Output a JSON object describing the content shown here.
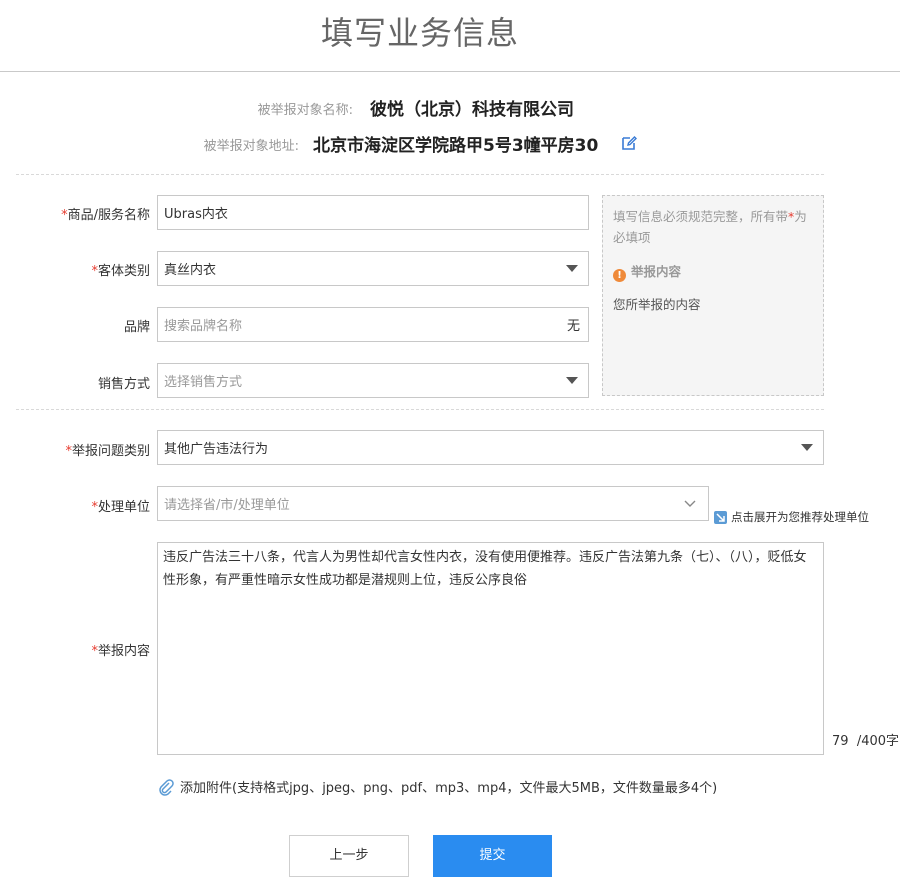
{
  "page": {
    "title": "填写业务信息"
  },
  "target": {
    "name_label": "被举报对象名称:",
    "name_value": "彼悦（北京）科技有限公司",
    "address_label": "被举报对象地址:",
    "address_value": "北京市海淀区学院路甲5号3幢平房30",
    "edit_icon": "edit-icon"
  },
  "form": {
    "required_mark": "*",
    "product": {
      "label": "商品/服务名称",
      "value": "Ubras内衣"
    },
    "category": {
      "label": "客体类别",
      "value": "真丝内衣"
    },
    "brand": {
      "label": "品牌",
      "placeholder": "搜索品牌名称",
      "suffix": "无"
    },
    "sales": {
      "label": "销售方式",
      "placeholder": "选择销售方式"
    },
    "issue_type": {
      "label": "举报问题类别",
      "value": "其他广告违法行为"
    },
    "handler": {
      "label": "处理单位",
      "placeholder": "请选择省/市/处理单位",
      "hint": "点击展开为您推荐处理单位"
    },
    "content": {
      "label": "举报内容",
      "value": "违反广告法三十八条，代言人为男性却代言女性内衣，没有使用便推荐。违反广告法第九条（七）、（八），贬低女性形象，有严重性暗示女性成功都是潜规则上位，违反公序良俗",
      "count": "79",
      "limit": "/400字"
    },
    "attachment": "添加附件(支持格式jpg、jpeg、png、pdf、mp3、mp4，文件最大5MB，文件数量最多4个)"
  },
  "notice": {
    "text_before": "填写信息必须规范完整，所有带",
    "text_star": "*",
    "text_after": "为必填项",
    "section_title": "举报内容",
    "section_body": "您所举报的内容"
  },
  "buttons": {
    "prev": "上一步",
    "submit": "提交"
  },
  "colors": {
    "primary": "#2a8cf0",
    "required": "#e63a2e",
    "warning": "#ef8a3a",
    "link_icon": "#3a7bd5"
  }
}
